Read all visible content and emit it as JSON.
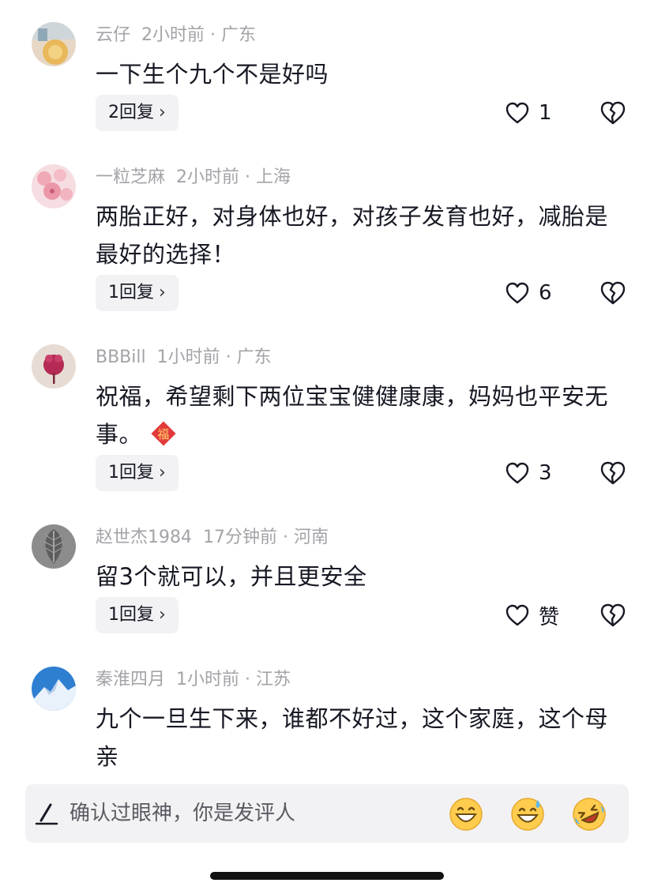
{
  "comments": [
    {
      "user": "云仔",
      "time": "2小时前 · 广东",
      "text": "一下生个九个不是好吗",
      "reply": "2回复",
      "likes": "1"
    },
    {
      "user": "一粒芝麻",
      "time": "2小时前 · 上海",
      "text": "两胎正好，对身体也好，对孩子发育也好，减胎是最好的选择！",
      "reply": "1回复",
      "likes": "6"
    },
    {
      "user": "BBBill",
      "time": "1小时前 · 广东",
      "text": "祝福，希望剩下两位宝宝健健康康，妈妈也平安无事。",
      "reply": "1回复",
      "likes": "3",
      "emoji": "福"
    },
    {
      "user": "赵世杰1984",
      "time": "17分钟前 · 河南",
      "text": "留3个就可以，并且更安全",
      "reply": "1回复",
      "likes": "赞"
    },
    {
      "user": "秦淮四月",
      "time": "1小时前 · 江苏",
      "text": "九个一旦生下来，谁都不好过，这个家庭，这个母亲"
    }
  ],
  "input": {
    "placeholder": "确认过眼神，你是发评人",
    "emojis": [
      "grinning-face",
      "grinning-sweat-face",
      "rolling-laughing-face"
    ]
  },
  "colors": {
    "text": "#161823",
    "meta": "#a3a3a8",
    "button_bg": "#f2f2f4"
  }
}
